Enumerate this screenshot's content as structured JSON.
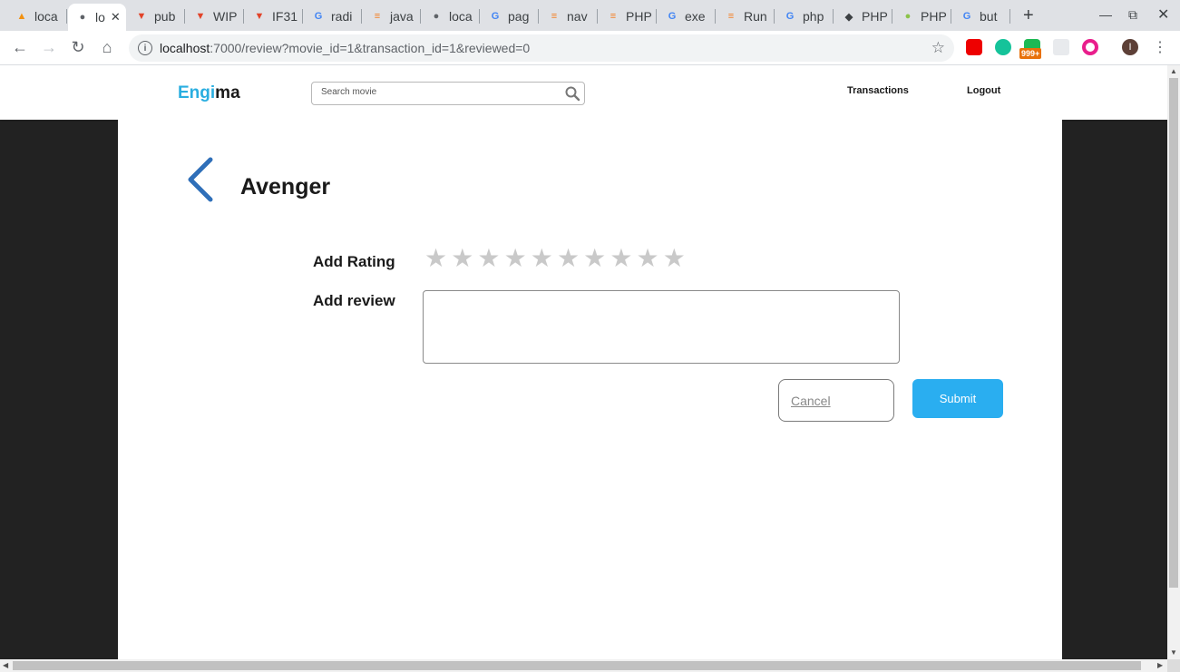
{
  "browser": {
    "tabs": [
      {
        "label": "loca",
        "icon": "phpmyadmin-icon"
      },
      {
        "label": "lo",
        "icon": "globe-icon",
        "active": true
      },
      {
        "label": "pub",
        "icon": "gitlab-icon"
      },
      {
        "label": "WIP",
        "icon": "gitlab-icon"
      },
      {
        "label": "IF31",
        "icon": "gitlab-icon"
      },
      {
        "label": "radi",
        "icon": "google-icon"
      },
      {
        "label": "java",
        "icon": "stackoverflow-icon"
      },
      {
        "label": "loca",
        "icon": "globe-icon"
      },
      {
        "label": "pag",
        "icon": "google-icon"
      },
      {
        "label": "nav",
        "icon": "stackoverflow-icon"
      },
      {
        "label": "PHP",
        "icon": "stackoverflow-icon"
      },
      {
        "label": "exe",
        "icon": "google-icon"
      },
      {
        "label": "Run",
        "icon": "stackoverflow-icon"
      },
      {
        "label": "php",
        "icon": "google-icon"
      },
      {
        "label": "PHP",
        "icon": "php-diamond-icon"
      },
      {
        "label": "PHP",
        "icon": "leaf-icon"
      },
      {
        "label": "but",
        "icon": "google-icon"
      }
    ],
    "url_host": "localhost",
    "url_rest": ":7000/review?movie_id=1&transaction_id=1&reviewed=0",
    "badge": "999+",
    "profile_initial": "I"
  },
  "header": {
    "logo_part1": "Engi",
    "logo_part2": "ma",
    "search_placeholder": "Search movie",
    "nav": {
      "transactions": "Transactions",
      "logout": "Logout"
    }
  },
  "review": {
    "movie_title": "Avenger",
    "rating_label": "Add Rating",
    "review_label": "Add review",
    "star_count": 10,
    "rating_value": 0,
    "review_text": "",
    "cancel_label": "Cancel",
    "submit_label": "Submit"
  },
  "colors": {
    "accent": "#2aaef0",
    "logo_blue": "#2aaee0",
    "back_arrow": "#2f6fb9",
    "star_empty": "#c9c9c9"
  }
}
